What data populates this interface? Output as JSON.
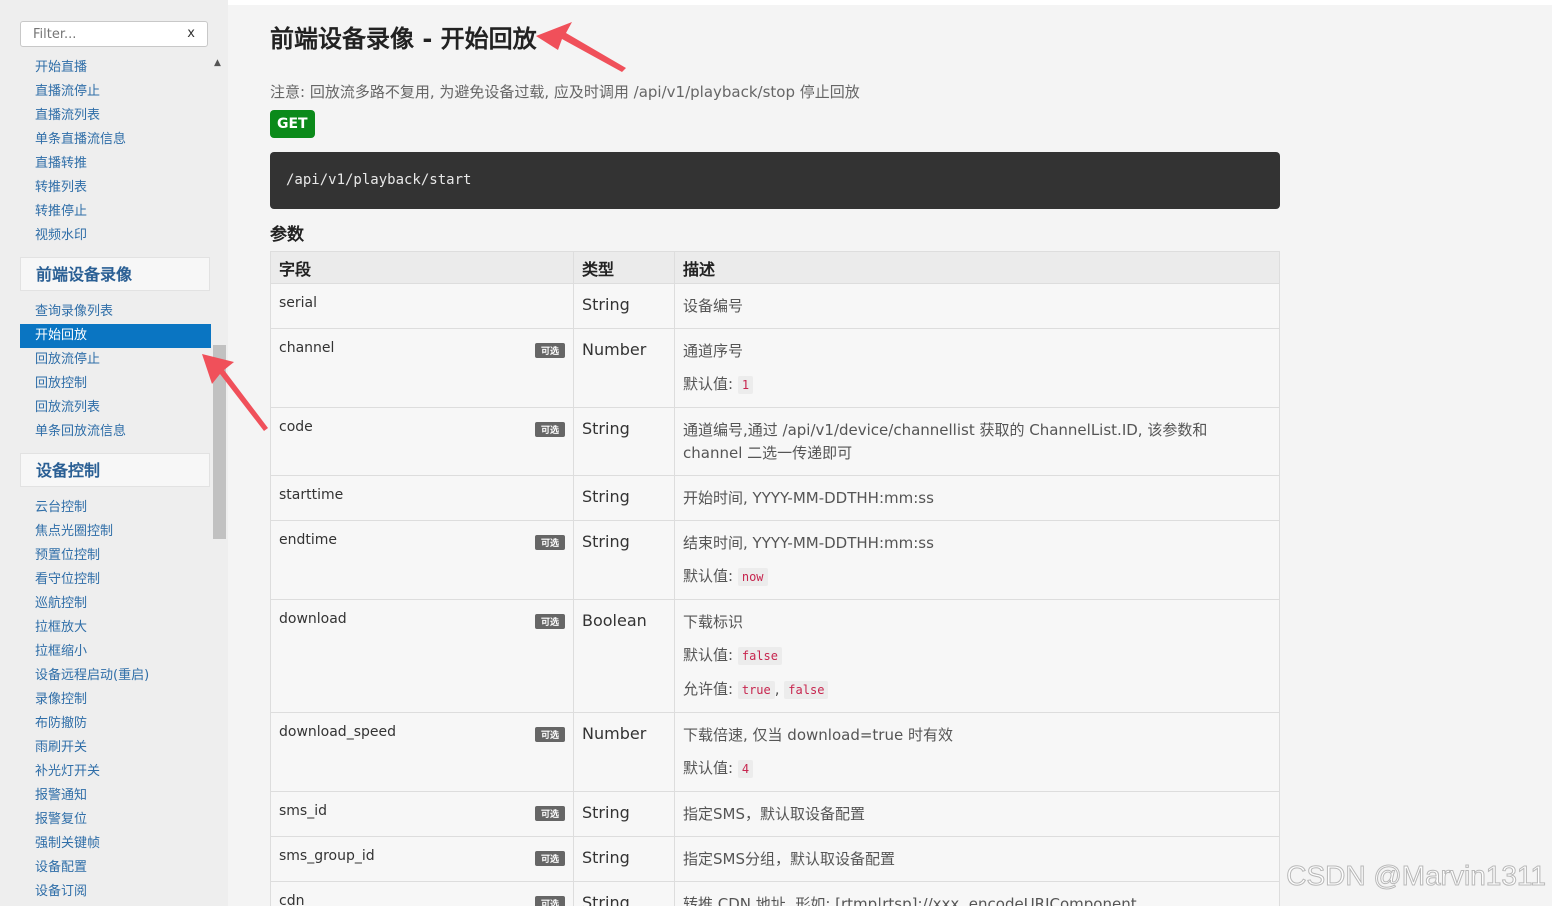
{
  "sidebar": {
    "filter_placeholder": "Filter...",
    "filter_clear": "x",
    "scroll_up": "▲",
    "items_top": [
      "开始直播",
      "直播流停止",
      "直播流列表",
      "单条直播流信息",
      "直播转推",
      "转推列表",
      "转推停止",
      "视频水印"
    ],
    "group_record": "前端设备录像",
    "items_record": [
      "查询录像列表",
      "开始回放",
      "回放流停止",
      "回放控制",
      "回放流列表",
      "单条回放流信息"
    ],
    "group_control": "设备控制",
    "items_control": [
      "云台控制",
      "焦点光圈控制",
      "预置位控制",
      "看守位控制",
      "巡航控制",
      "拉框放大",
      "拉框缩小",
      "设备远程启动(重启)",
      "录像控制",
      "布防撤防",
      "雨刷开关",
      "补光灯开关",
      "报警通知",
      "报警复位",
      "强制关键帧",
      "设备配置",
      "设备订阅"
    ]
  },
  "main": {
    "title": "前端设备录像 - 开始回放",
    "note": "注意: 回放流多路不复用, 为避免设备过载, 应及时调用 /api/v1/playback/stop 停止回放",
    "method": "GET",
    "endpoint": "/api/v1/playback/start",
    "params_heading": "参数",
    "table": {
      "headers": [
        "字段",
        "类型",
        "描述"
      ],
      "optional_label": "可选",
      "default_label": "默认值:",
      "allowed_label": "允许值:",
      "rows": [
        {
          "field": "serial",
          "type": "String",
          "desc": "设备编号"
        },
        {
          "field": "channel",
          "type": "Number",
          "desc": "通道序号",
          "default": "1"
        },
        {
          "field": "code",
          "type": "String",
          "desc": "通道编号,通过 /api/v1/device/channellist 获取的 ChannelList.ID, 该参数和 channel 二选一传递即可"
        },
        {
          "field": "starttime",
          "type": "String",
          "desc": "开始时间, YYYY-MM-DDTHH:mm:ss"
        },
        {
          "field": "endtime",
          "type": "String",
          "desc": "结束时间, YYYY-MM-DDTHH:mm:ss",
          "default": "now"
        },
        {
          "field": "download",
          "type": "Boolean",
          "desc": "下载标识",
          "default": "false",
          "allowed": [
            "true",
            "false"
          ]
        },
        {
          "field": "download_speed",
          "type": "Number",
          "desc": "下载倍速, 仅当 download=true 时有效",
          "default": "4"
        },
        {
          "field": "sms_id",
          "type": "String",
          "desc": "指定SMS，默认取设备配置"
        },
        {
          "field": "sms_group_id",
          "type": "String",
          "desc": "指定SMS分组，默认取设备配置"
        },
        {
          "field": "cdn",
          "type": "String",
          "desc": "转推 CDN 地址, 形如: [rtmp|rtsp]://xxx, encodeURIComponent"
        }
      ]
    }
  },
  "watermark": "CSDN @Marvin1311",
  "colors": {
    "nav_link": "#2f6ea8",
    "nav_active_bg": "#0a75c2",
    "get_badge": "#0b8a1a",
    "code_bg": "#333333",
    "annotation_arrow": "#f0505a"
  }
}
